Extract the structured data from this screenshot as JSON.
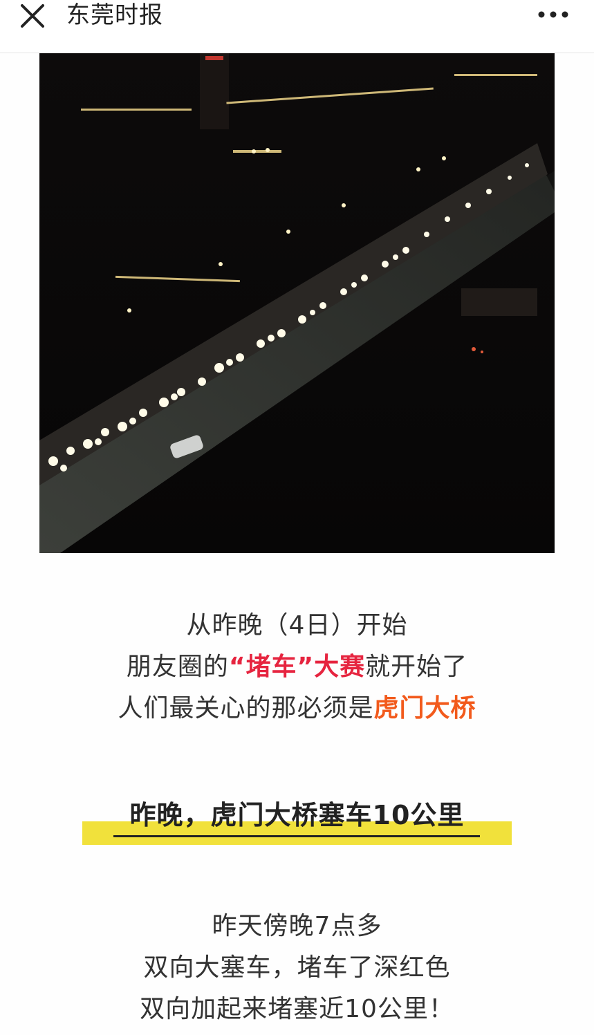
{
  "header": {
    "title": "东莞时报",
    "close_icon": "close-icon",
    "more_icon": "more-dots-icon"
  },
  "article": {
    "image_alt": "夜间虎门大桥车流",
    "intro": {
      "line1": "从昨晚（4日）开始",
      "line2_prefix": "朋友圈的",
      "line2_highlight": "“堵车”大赛",
      "line2_suffix": "就开始了",
      "line3_prefix": "人们最关心的那必须是",
      "line3_highlight": "虎门大桥"
    },
    "headline": "昨晚，虎门大桥塞车10公里",
    "body": {
      "line1": "昨天傍晚7点多",
      "line2": "双向大塞车，堵车了深红色",
      "line3": "双向加起来堵塞近10公里！"
    }
  },
  "colors": {
    "red_highlight": "#e6243f",
    "orange_highlight": "#f25a1c",
    "headline_bar": "#f1e13b"
  }
}
